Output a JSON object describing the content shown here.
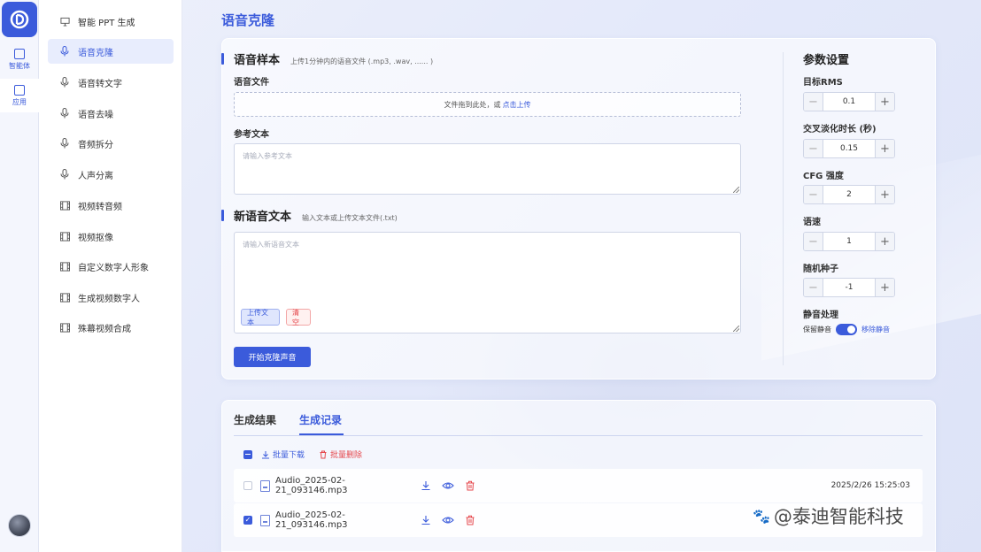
{
  "rail": {
    "items": [
      {
        "label": "智能体",
        "icon": "robot-icon"
      },
      {
        "label": "应用",
        "icon": "app-icon"
      }
    ]
  },
  "sidebar": {
    "items": [
      {
        "label": "智能 PPT 生成",
        "icon": "presentation-icon"
      },
      {
        "label": "语音克隆",
        "icon": "microphone-icon"
      },
      {
        "label": "语音转文字",
        "icon": "microphone-icon"
      },
      {
        "label": "语音去噪",
        "icon": "microphone-icon"
      },
      {
        "label": "音频拆分",
        "icon": "microphone-icon"
      },
      {
        "label": "人声分离",
        "icon": "microphone-icon"
      },
      {
        "label": "视频转音频",
        "icon": "film-icon"
      },
      {
        "label": "视频抠像",
        "icon": "film-icon"
      },
      {
        "label": "自定义数字人形象",
        "icon": "film-icon"
      },
      {
        "label": "生成视频数字人",
        "icon": "film-icon"
      },
      {
        "label": "殊幕视频合成",
        "icon": "film-icon"
      }
    ]
  },
  "page": {
    "title": "语音克隆"
  },
  "sample": {
    "title": "语音样本",
    "hint": "上传1分钟内的语音文件 (.mp3, .wav, ...... )",
    "file_label": "语音文件",
    "drop_text": "文件拖到此处，或",
    "drop_link": "点击上传",
    "ref_label": "参考文本",
    "ref_placeholder": "请输入参考文本"
  },
  "new_text": {
    "title": "新语音文本",
    "hint": "输入文本或上传文本文件(.txt)",
    "placeholder": "请输入新语音文本",
    "upload_label": "上传文本",
    "clear_label": "清空"
  },
  "start_button": "开始克隆声音",
  "params": {
    "title": "参数设置",
    "items": [
      {
        "label": "目标RMS",
        "value": "0.1"
      },
      {
        "label": "交叉淡化时长 (秒)",
        "value": "0.15"
      },
      {
        "label": "CFG 强度",
        "value": "2"
      },
      {
        "label": "语速",
        "value": "1"
      },
      {
        "label": "随机种子",
        "value": "-1"
      }
    ],
    "silence_label": "静音处理",
    "silence_keep": "保留静音",
    "silence_remove": "移除静音"
  },
  "results": {
    "tabs": [
      "生成结果",
      "生成记录"
    ],
    "bulk_download": "批量下载",
    "bulk_delete": "批量删除",
    "rows": [
      {
        "name": "Audio_2025-02-21_093146.mp3",
        "date": "2025/2/26 15:25:03"
      },
      {
        "name": "Audio_2025-02-21_093146.mp3",
        "date": ""
      }
    ]
  },
  "watermark": "@泰迪智能科技",
  "colors": {
    "accent": "#3b5bdb",
    "danger": "#e5484d"
  }
}
